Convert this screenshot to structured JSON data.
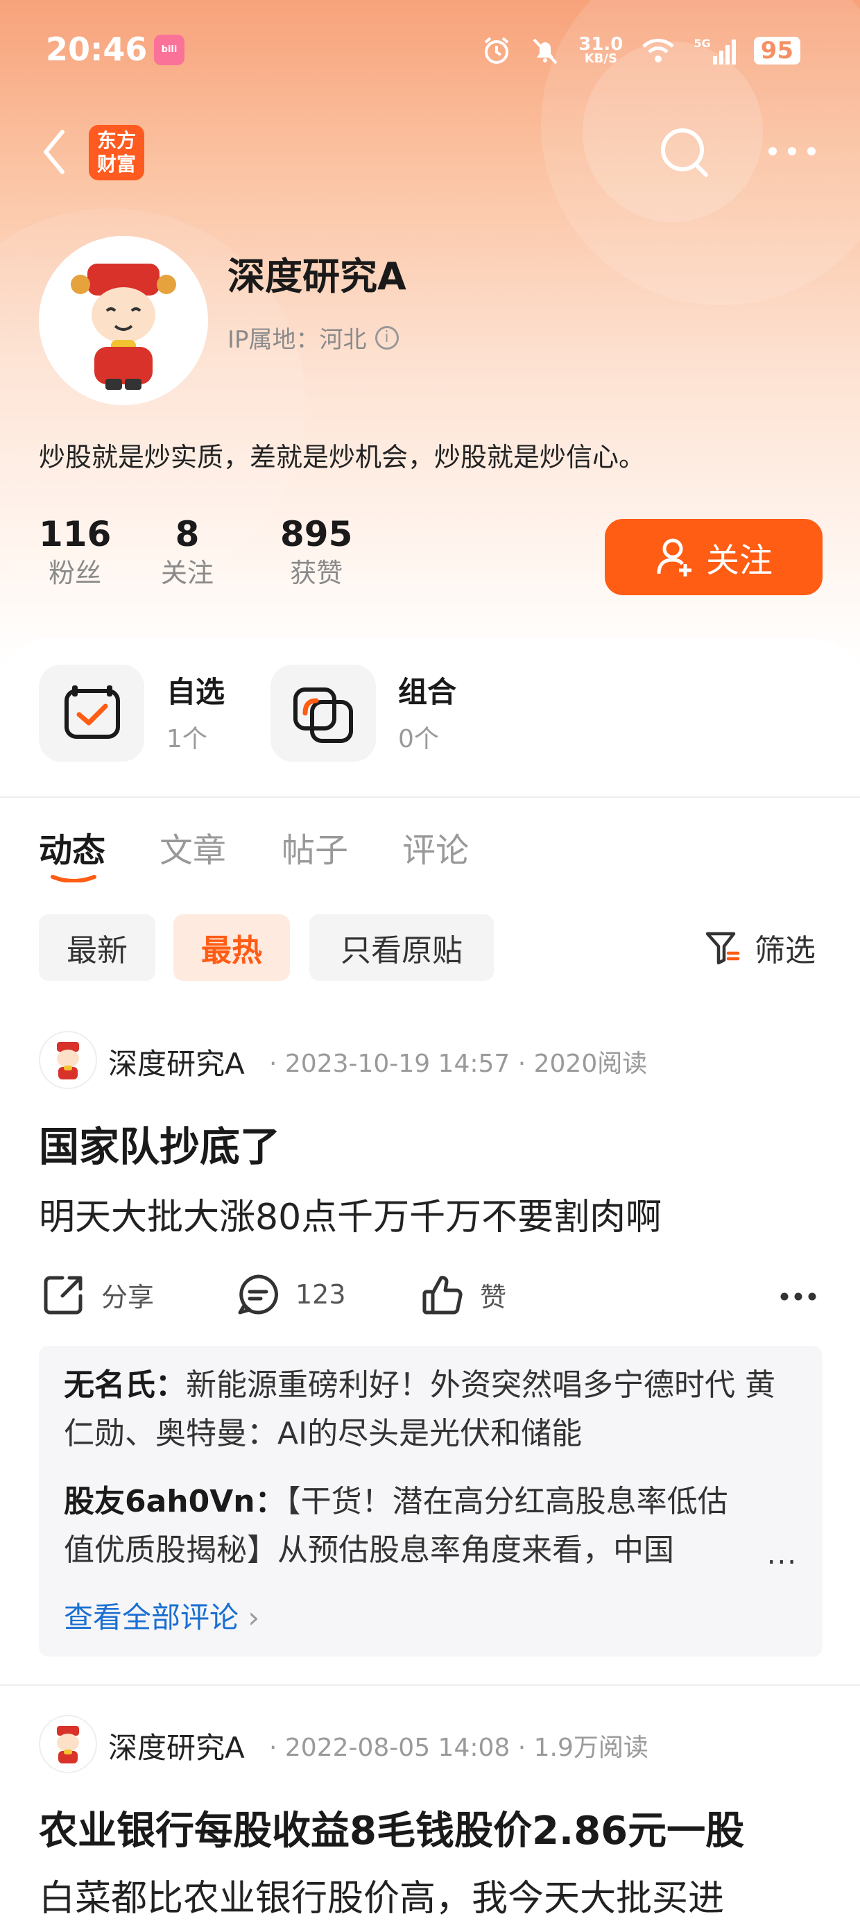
{
  "status_bar": {
    "time": "20:46",
    "speed_value": "31.0",
    "speed_unit": "KB/S",
    "network": "5G",
    "battery": "95"
  },
  "header": {
    "logo_text_line1": "东方",
    "logo_text_line2": "财富"
  },
  "profile": {
    "name": "深度研究A",
    "ip": "IP属地：河北",
    "bio": "炒股就是炒实质，差就是炒机会，炒股就是炒信心。",
    "stats": [
      {
        "value": "116",
        "label": "粉丝"
      },
      {
        "value": "8",
        "label": "关注"
      },
      {
        "value": "895",
        "label": "获赞"
      }
    ],
    "follow_label": "关注"
  },
  "shortcuts": [
    {
      "title": "自选",
      "count": "1个"
    },
    {
      "title": "组合",
      "count": "0个"
    }
  ],
  "tabs": [
    "动态",
    "文章",
    "帖子",
    "评论"
  ],
  "filters": {
    "chips": [
      "最新",
      "最热",
      "只看原贴"
    ],
    "filter_label": "筛选"
  },
  "posts": [
    {
      "author": "深度研究A",
      "meta": "· 2023-10-19 14:57 · 2020阅读",
      "title": "国家队抄底了",
      "body": "明天大批大涨80点千万千万不要割肉啊",
      "actions": {
        "share": "分享",
        "comments": "123",
        "like": "赞"
      },
      "comments": [
        {
          "user": "无名氏：",
          "text": "新能源重磅利好！外资突然唱多宁德时代 黄仁勋、奥特曼：AI的尽头是光伏和储能"
        },
        {
          "user": "股友6ah0Vn：",
          "text": "【干货！潜在高分红高股息率低估值优质股揭秘】从预估股息率角度来看，中国"
        }
      ],
      "comment_more": "...",
      "see_all": "查看全部评论"
    },
    {
      "author": "深度研究A",
      "meta": "· 2022-08-05 14:08 · 1.9万阅读",
      "title": "农业银行每股收益8毛钱股价2.86元一股",
      "body": "白菜都比农业银行股价高，我今天大批买进"
    }
  ],
  "colors": {
    "accent": "#ff5c14",
    "link": "#1a6fd1"
  }
}
